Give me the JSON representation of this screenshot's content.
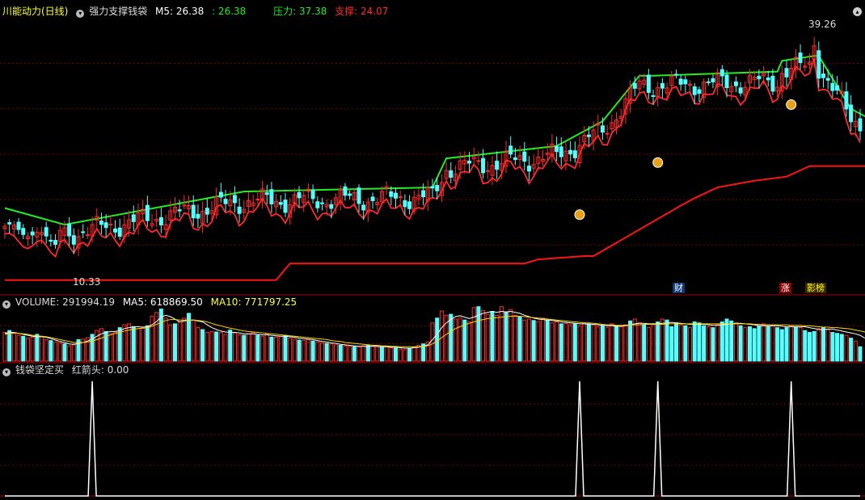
{
  "colors": {
    "up": "#ff2a2a",
    "down": "#54ffff",
    "resist": "#22ee22",
    "support": "#ff1414",
    "ma5": "#ffffff",
    "ma10": "#ffd800",
    "signal": "#ffffff",
    "grid": "#7a0000",
    "label_yellow": "#ffff3a"
  },
  "header": {
    "stock_title": "川能动力(日线)",
    "indicator_name": "强力支撑钱袋",
    "m5_label": "M5: 26.38",
    "m5_dup": ": 26.38",
    "pressure_label": "压力: 37.38",
    "support_label": "支撑: 24.07"
  },
  "main_panel": {
    "max_price_label": "39.26",
    "min_price_label": "10.33"
  },
  "badges": {
    "cai": "财",
    "zhang": "涨",
    "yingbang": "影榜"
  },
  "volume_panel": {
    "volume_label": "VOLUME: 291994.19",
    "ma5_label": "MA5: 618869.50",
    "ma10_label": "MA10: 771797.25"
  },
  "signal_panel": {
    "indicator_label": "钱袋坚定买",
    "arrow_label": "红箭头: 0.00"
  },
  "chart_data": [
    {
      "type": "candlestick",
      "name": "price",
      "ylim": [
        9,
        42
      ],
      "resistance": [
        [
          0,
          19.0
        ],
        [
          13,
          17.0
        ],
        [
          52,
          21.0
        ],
        [
          93,
          21.5
        ],
        [
          96,
          25.0
        ],
        [
          120,
          26.5
        ],
        [
          130,
          29.5
        ],
        [
          138,
          35.0
        ],
        [
          141,
          35.0
        ],
        [
          168,
          35.5
        ],
        [
          169,
          36.8
        ],
        [
          176,
          37.38
        ],
        [
          177,
          37.38
        ],
        [
          184,
          31.0
        ],
        [
          189,
          29.5
        ]
      ],
      "support": [
        [
          0,
          10.3
        ],
        [
          59,
          10.3
        ],
        [
          62,
          12.3
        ],
        [
          113,
          12.3
        ],
        [
          116,
          12.8
        ],
        [
          126,
          13.2
        ],
        [
          128,
          13.2
        ],
        [
          147,
          19.3
        ],
        [
          150,
          20.2
        ],
        [
          155,
          21.5
        ],
        [
          163,
          22.3
        ],
        [
          170,
          22.8
        ],
        [
          175,
          24.07
        ],
        [
          189,
          24.07
        ]
      ],
      "max": 39.26,
      "min": 10.33
    },
    {
      "type": "bar",
      "name": "volume",
      "ylim": [
        0,
        1100000
      ],
      "values": [
        600000,
        640000,
        580000,
        540000,
        520000,
        480000,
        500000,
        560000,
        520000,
        450000,
        430000,
        400000,
        380000,
        360000,
        320000,
        340000,
        450000,
        460000,
        490000,
        560000,
        640000,
        680000,
        620000,
        580000,
        610000,
        700000,
        760000,
        780000,
        720000,
        680000,
        690000,
        740000,
        940000,
        1020000,
        1090000,
        900000,
        760000,
        780000,
        820000,
        900000,
        1000000,
        860000,
        700000,
        660000,
        600000,
        620000,
        610000,
        600000,
        560000,
        650000,
        590000,
        550000,
        540000,
        570000,
        600000,
        540000,
        520000,
        560000,
        500000,
        500000,
        520000,
        540000,
        480000,
        460000,
        440000,
        430000,
        450000,
        420000,
        400000,
        380000,
        370000,
        360000,
        340000,
        330000,
        320000,
        310000,
        300000,
        300000,
        320000,
        340000,
        310000,
        300000,
        290000,
        300000,
        280000,
        270000,
        250000,
        240000,
        270000,
        300000,
        330000,
        360000,
        400000,
        800000,
        900000,
        1050000,
        960000,
        980000,
        880000,
        900000,
        860000,
        820000,
        1120000,
        1140000,
        1060000,
        980000,
        1040000,
        960000,
        1140000,
        1020000,
        1080000,
        960000,
        920000,
        860000,
        880000,
        850000,
        830000,
        900000,
        860000,
        800000,
        820000,
        780000,
        790000,
        760000,
        780000,
        740000,
        800000,
        780000,
        760000,
        720000,
        740000,
        700000,
        780000,
        740000,
        720000,
        760000,
        840000,
        880000,
        800000,
        760000,
        700000,
        760000,
        820000,
        880000,
        860000,
        720000,
        800000,
        760000,
        740000,
        700000,
        820000,
        800000,
        740000,
        720000,
        700000,
        760000,
        820000,
        880000,
        840000,
        800000,
        740000,
        700000,
        720000,
        680000,
        740000,
        780000,
        720000,
        740000,
        700000,
        660000,
        700000,
        740000,
        720000,
        700000,
        640000,
        600000,
        620000,
        680000,
        700000,
        660000,
        600000,
        580000,
        560000,
        540000,
        480000,
        420000,
        300000
      ],
      "ma5": [
        580000,
        600000,
        600000,
        580000,
        560000,
        540000,
        520000,
        510000,
        510000,
        500000,
        470000,
        440000,
        410000,
        390000,
        360000,
        350000,
        370000,
        390000,
        420000,
        460000,
        520000,
        570000,
        600000,
        620000,
        620000,
        640000,
        680000,
        700000,
        720000,
        720000,
        710000,
        720000,
        760000,
        830000,
        920000,
        960000,
        930000,
        880000,
        820000,
        840000,
        860000,
        860000,
        840000,
        820000,
        760000,
        700000,
        660000,
        630000,
        610000,
        600000,
        600000,
        590000,
        570000,
        570000,
        570000,
        560000,
        550000,
        550000,
        540000,
        530000,
        520000,
        520000,
        510000,
        500000,
        480000,
        470000,
        460000,
        450000,
        430000,
        410000,
        400000,
        380000,
        370000,
        350000,
        340000,
        330000,
        320000,
        310000,
        310000,
        310000,
        310000,
        310000,
        300000,
        300000,
        290000,
        290000,
        280000,
        270000,
        270000,
        280000,
        290000,
        310000,
        340000,
        450000,
        560000,
        700000,
        800000,
        870000,
        930000,
        950000,
        920000,
        890000,
        920000,
        960000,
        1000000,
        1020000,
        1040000,
        1020000,
        1040000,
        1030000,
        1040000,
        1020000,
        1000000,
        960000,
        930000,
        900000,
        880000,
        870000,
        860000,
        850000,
        840000,
        820000,
        810000,
        800000,
        790000,
        780000,
        780000,
        770000,
        770000,
        760000,
        750000,
        740000,
        740000,
        730000,
        730000,
        740000,
        760000,
        780000,
        790000,
        790000,
        780000,
        780000,
        780000,
        790000,
        800000,
        810000,
        800000,
        790000,
        780000,
        770000,
        770000,
        770000,
        770000,
        760000,
        750000,
        750000,
        760000,
        770000,
        780000,
        790000,
        790000,
        780000,
        770000,
        760000,
        740000,
        740000,
        740000,
        740000,
        740000,
        730000,
        720000,
        720000,
        720000,
        720000,
        720000,
        700000,
        680000,
        660000,
        660000,
        670000,
        670000,
        650000,
        630000,
        610000,
        590000,
        570000,
        540000,
        480000
      ],
      "ma10": [
        560000,
        580000,
        590000,
        580000,
        570000,
        560000,
        540000,
        530000,
        520000,
        510000,
        490000,
        470000,
        450000,
        430000,
        410000,
        390000,
        390000,
        390000,
        400000,
        420000,
        450000,
        480000,
        520000,
        550000,
        580000,
        600000,
        630000,
        650000,
        670000,
        680000,
        690000,
        700000,
        730000,
        770000,
        810000,
        850000,
        870000,
        870000,
        860000,
        860000,
        860000,
        860000,
        850000,
        840000,
        820000,
        790000,
        760000,
        740000,
        710000,
        690000,
        670000,
        650000,
        630000,
        620000,
        610000,
        600000,
        590000,
        580000,
        570000,
        560000,
        550000,
        540000,
        530000,
        520000,
        510000,
        500000,
        490000,
        480000,
        470000,
        460000,
        450000,
        430000,
        420000,
        410000,
        390000,
        380000,
        370000,
        360000,
        350000,
        340000,
        330000,
        330000,
        320000,
        320000,
        310000,
        310000,
        300000,
        300000,
        300000,
        300000,
        300000,
        310000,
        320000,
        360000,
        420000,
        490000,
        560000,
        620000,
        680000,
        720000,
        760000,
        790000,
        820000,
        850000,
        870000,
        890000,
        900000,
        910000,
        920000,
        930000,
        940000,
        940000,
        940000,
        930000,
        920000,
        910000,
        900000,
        890000,
        880000,
        870000,
        860000,
        850000,
        840000,
        830000,
        820000,
        810000,
        800000,
        800000,
        790000,
        780000,
        770000,
        760000,
        760000,
        750000,
        750000,
        750000,
        760000,
        760000,
        760000,
        770000,
        770000,
        770000,
        770000,
        770000,
        780000,
        780000,
        780000,
        780000,
        780000,
        780000,
        780000,
        780000,
        780000,
        780000,
        780000,
        780000,
        780000,
        780000,
        780000,
        780000,
        780000,
        780000,
        780000,
        770000,
        770000,
        760000,
        760000,
        760000,
        760000,
        760000,
        760000,
        750000,
        750000,
        750000,
        740000,
        740000,
        730000,
        720000,
        710000,
        710000,
        700000,
        700000,
        690000,
        680000,
        670000,
        650000,
        630000,
        610000,
        590000,
        560000
      ]
    },
    {
      "type": "line",
      "name": "signal",
      "ylim": [
        0,
        1
      ],
      "spike_indices": [
        19,
        125,
        142,
        171
      ]
    }
  ]
}
